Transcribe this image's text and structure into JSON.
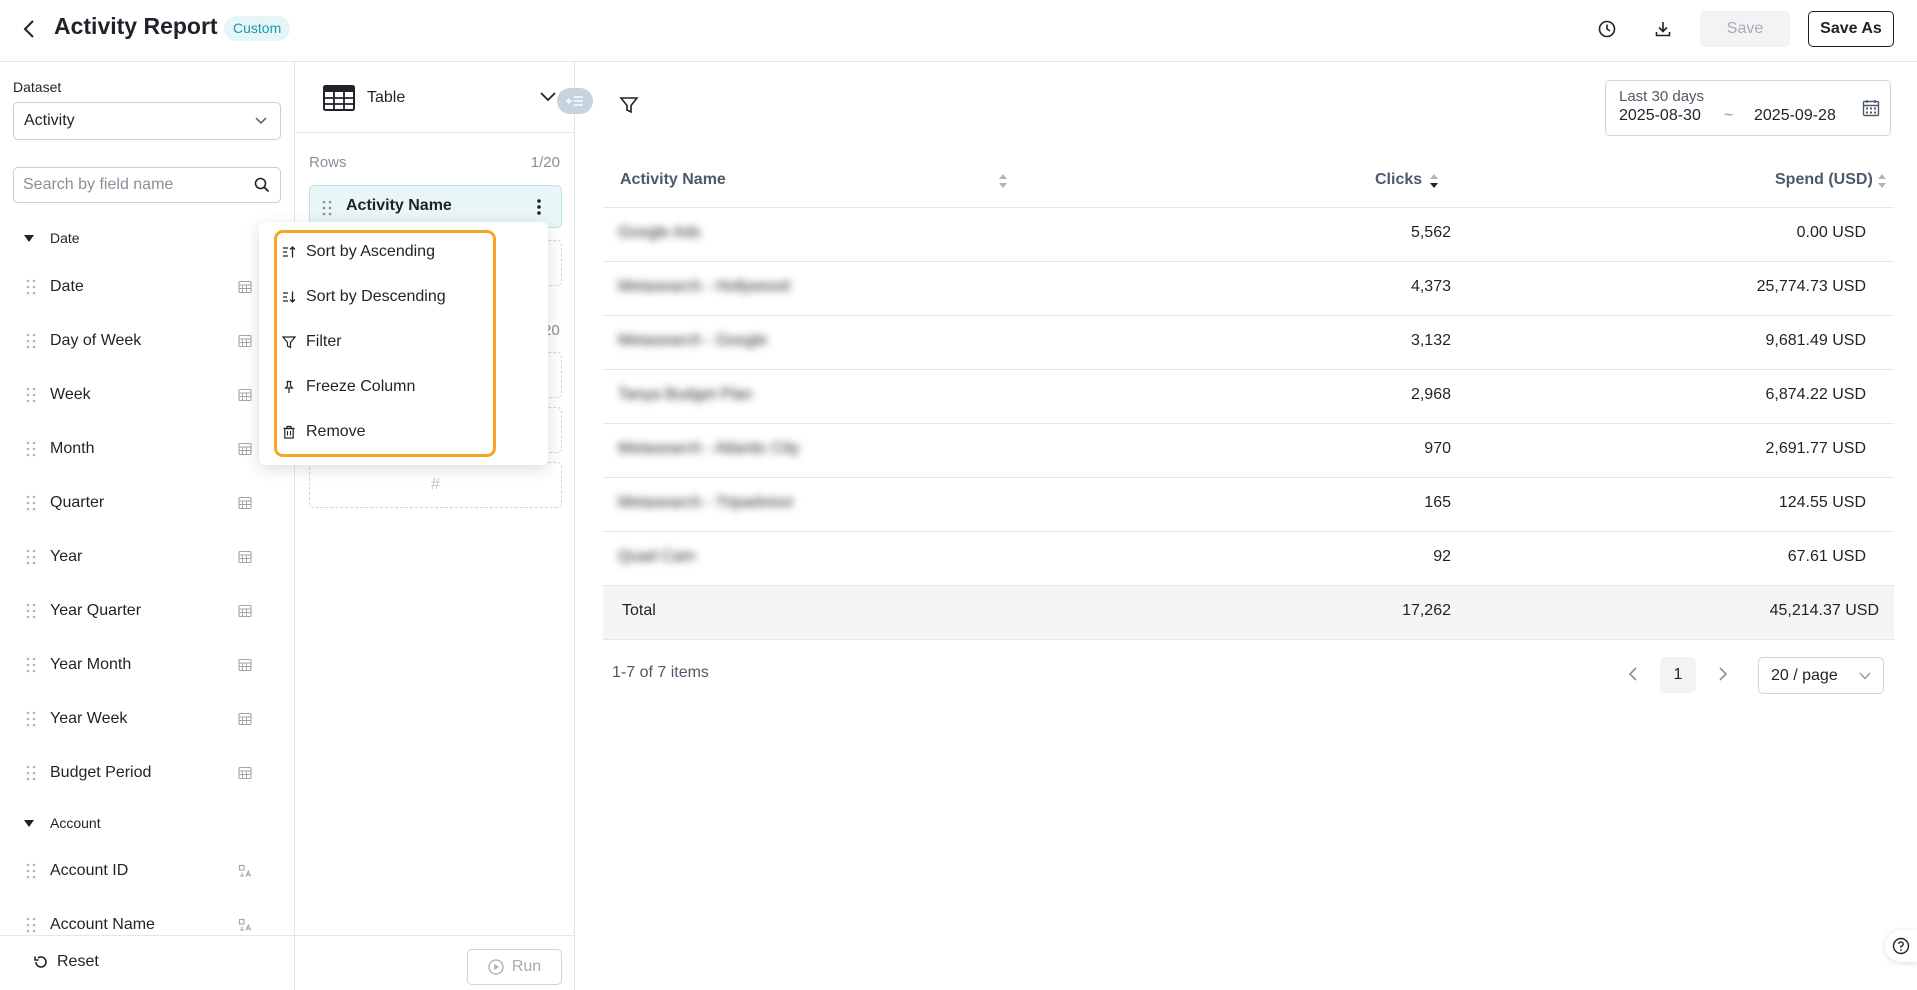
{
  "header": {
    "title": "Activity Report",
    "badge": "Custom",
    "save_label": "Save",
    "save_as_label": "Save As"
  },
  "sidebar": {
    "dataset_label": "Dataset",
    "dataset_value": "Activity",
    "search_placeholder": "Search by field name",
    "groups": [
      {
        "name": "Date",
        "fields": [
          "Date",
          "Day of Week",
          "Week",
          "Month",
          "Quarter",
          "Year",
          "Year Quarter",
          "Year Month",
          "Year Week",
          "Budget Period"
        ]
      },
      {
        "name": "Account",
        "fields": [
          "Account ID",
          "Account Name"
        ]
      }
    ],
    "reset_label": "Reset"
  },
  "config": {
    "viz_type": "Table",
    "rows_label": "Rows",
    "rows_count": "1/20",
    "row_chip": "Activity Name",
    "partial_count": "20",
    "hash_placeholder": "#",
    "run_label": "Run"
  },
  "context_menu": {
    "items": [
      "Sort by Ascending",
      "Sort by Descending",
      "Filter",
      "Freeze Column",
      "Remove"
    ]
  },
  "date_range": {
    "label": "Last 30 days",
    "start": "2025-08-30",
    "separator": "~",
    "end": "2025-09-28"
  },
  "table": {
    "columns": [
      "Activity Name",
      "Clicks",
      "Spend (USD)"
    ],
    "rows": [
      {
        "name": "Google Ads",
        "clicks": "5,562",
        "spend": "0.00 USD"
      },
      {
        "name": "Metasearch - Hollywood",
        "clicks": "4,373",
        "spend": "25,774.73 USD"
      },
      {
        "name": "Metasearch - Google",
        "clicks": "3,132",
        "spend": "9,681.49 USD"
      },
      {
        "name": "Tanya Budget Plan",
        "clicks": "2,968",
        "spend": "6,874.22 USD"
      },
      {
        "name": "Metasearch - Atlantic City",
        "clicks": "970",
        "spend": "2,691.77 USD"
      },
      {
        "name": "Metasearch - Tripadvisor",
        "clicks": "165",
        "spend": "124.55 USD"
      },
      {
        "name": "Quad Cam",
        "clicks": "92",
        "spend": "67.61 USD"
      }
    ],
    "total": {
      "label": "Total",
      "clicks": "17,262",
      "spend": "45,214.37 USD"
    }
  },
  "pagination": {
    "info": "1-7 of 7 items",
    "current": "1",
    "page_size": "20 / page"
  },
  "colors": {
    "accent": "#1b9aa6",
    "highlight": "#f5a623",
    "chip_bg": "#e8f6f8"
  }
}
